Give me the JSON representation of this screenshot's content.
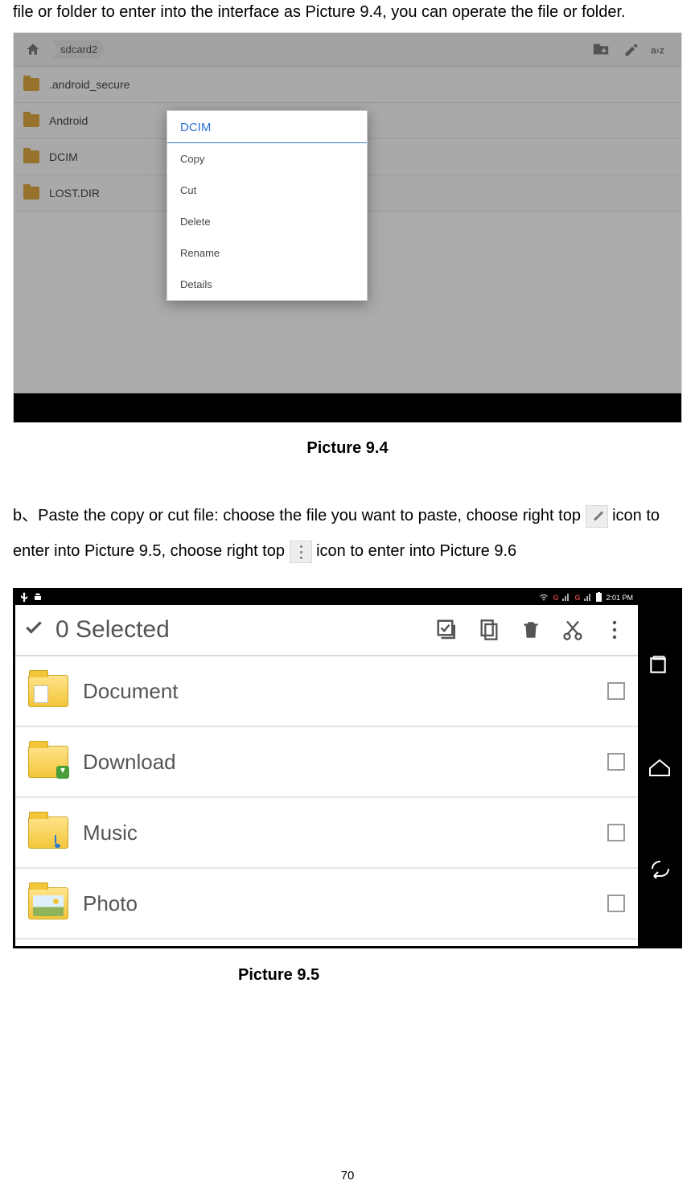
{
  "intro": "file or folder to enter into the interface as Picture 9.4, you can operate the file or folder.",
  "pic94": {
    "breadcrumb": "sdcard2",
    "folders": [
      ".android_secure",
      "Android",
      "DCIM",
      "LOST.DIR"
    ],
    "context_menu": {
      "title": "DCIM",
      "items": [
        "Copy",
        "Cut",
        "Delete",
        "Rename",
        "Details"
      ]
    },
    "caption": "Picture 9.4"
  },
  "para_b": {
    "prefix": "b、Paste the copy or cut file: choose the file you want to paste, choose right top ",
    "mid": " icon to enter into Picture 9.5, choose right top ",
    "suffix": " icon to enter into Picture 9.6"
  },
  "pic95": {
    "status_time": "2:01 PM",
    "selected_label": "0 Selected",
    "folders": [
      "Document",
      "Download",
      "Music",
      "Photo"
    ],
    "caption": "Picture 9.5"
  },
  "page_number": "70"
}
